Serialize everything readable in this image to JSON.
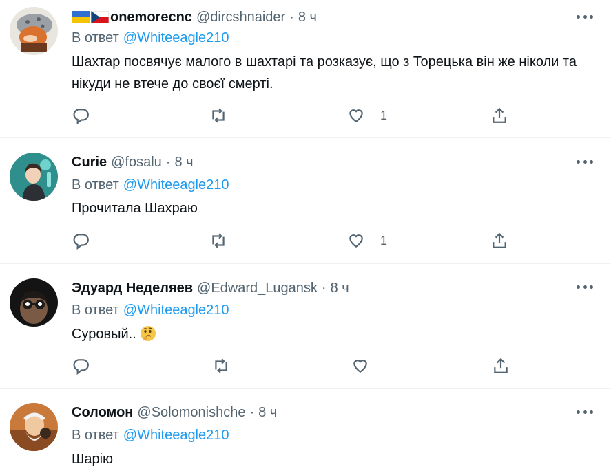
{
  "tweets": [
    {
      "flags": [
        "ukraine-flag",
        "czech-flag"
      ],
      "name": "onemorecnc",
      "handle": "@dircshnaider",
      "dot": "·",
      "time": "8 ч",
      "reply_prefix": "В ответ",
      "reply_mention": "@Whiteeagle210",
      "text": "Шахтар посвячує малого в шахтарі та розказує, що з Торецька він же ніколи та нікуди не втече до своєї смерті.",
      "like_count": "1"
    },
    {
      "name": "Curie",
      "handle": "@fosalu",
      "dot": "·",
      "time": "8 ч",
      "reply_prefix": "В ответ",
      "reply_mention": "@Whiteeagle210",
      "text": "Прочитала Шахраю",
      "like_count": "1"
    },
    {
      "name": "Эдуард Неделяев",
      "handle": "@Edward_Lugansk",
      "dot": "·",
      "time": "8 ч",
      "reply_prefix": "В ответ",
      "reply_mention": "@Whiteeagle210",
      "text": "Суровый..",
      "emoji": "thinking-face-emoji",
      "like_count": ""
    },
    {
      "name": "Соломон",
      "handle": "@Solomonishche",
      "dot": "·",
      "time": "8 ч",
      "reply_prefix": "В ответ",
      "reply_mention": "@Whiteeagle210",
      "text": "Шарію"
    }
  ],
  "icons": {
    "reply": "reply-icon",
    "retweet": "retweet-icon",
    "like": "like-icon",
    "share": "share-icon",
    "more": "more-icon"
  },
  "colors": {
    "link": "#1d9bf0",
    "secondary": "#536471",
    "text": "#0f1419",
    "divider": "#eff3f4"
  }
}
